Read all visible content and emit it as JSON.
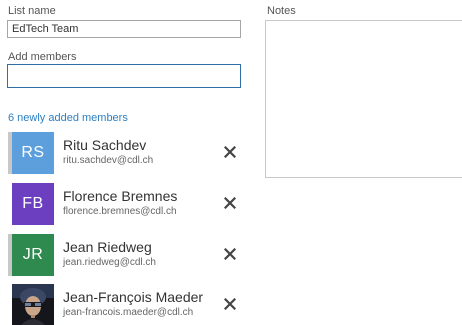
{
  "form": {
    "list_name_label": "List name",
    "list_name_value": "EdTech Team",
    "add_members_label": "Add members",
    "add_members_value": "",
    "notes_label": "Notes",
    "notes_value": ""
  },
  "members_header": {
    "count_text": "6 newly added members"
  },
  "members": [
    {
      "initials": "RS",
      "name": "Ritu Sachdev",
      "email": "ritu.sachdev@cdl.ch",
      "avatar_color": "#5d9fdc",
      "strip_color": "#c8c8c8",
      "avatar_kind": "initials",
      "remove_icon": "close-icon"
    },
    {
      "initials": "FB",
      "name": "Florence Bremnes",
      "email": "florence.bremnes@cdl.ch",
      "avatar_color": "#6b3fbf",
      "strip_color": "#ffffff",
      "avatar_kind": "initials",
      "remove_icon": "close-icon"
    },
    {
      "initials": "JR",
      "name": "Jean Riedweg",
      "email": "jean.riedweg@cdl.ch",
      "avatar_color": "#2e8a4e",
      "strip_color": "#c8c8c8",
      "avatar_kind": "initials",
      "remove_icon": "close-icon"
    },
    {
      "initials": "",
      "name": "Jean-François Maeder",
      "email": "jean-francois.maeder@cdl.ch",
      "avatar_color": "#1a1a1f",
      "strip_color": "#ffffff",
      "avatar_kind": "photo",
      "remove_icon": "close-icon"
    }
  ],
  "colors": {
    "accent": "#2b7fc3",
    "input_focus_border": "#2f6fa6",
    "text": "#333333"
  }
}
